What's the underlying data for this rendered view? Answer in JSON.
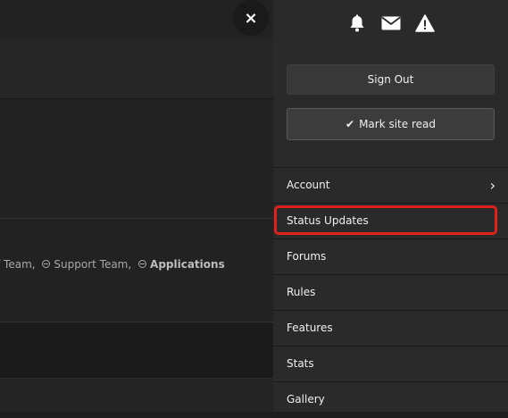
{
  "background": {
    "groups": [
      {
        "label": "f Team,",
        "icon": ""
      },
      {
        "label": "Support Team,",
        "icon": "minus-circle-icon"
      },
      {
        "label": "Applications",
        "icon": "minus-circle-icon",
        "bold": true
      }
    ]
  },
  "close": {
    "label": "×"
  },
  "drawer": {
    "icons": [
      "bell-icon",
      "envelope-icon",
      "warning-icon"
    ],
    "sign_out": "Sign Out",
    "mark_read": "Mark site read",
    "menu": [
      {
        "label": "Account",
        "has_submenu": true
      },
      {
        "label": "Status Updates",
        "highlighted": true
      },
      {
        "label": "Forums"
      },
      {
        "label": "Rules"
      },
      {
        "label": "Features"
      },
      {
        "label": "Stats"
      },
      {
        "label": "Gallery"
      }
    ]
  },
  "colors": {
    "highlight": "#e0201a",
    "drawer_bg": "#2a2a2a"
  }
}
